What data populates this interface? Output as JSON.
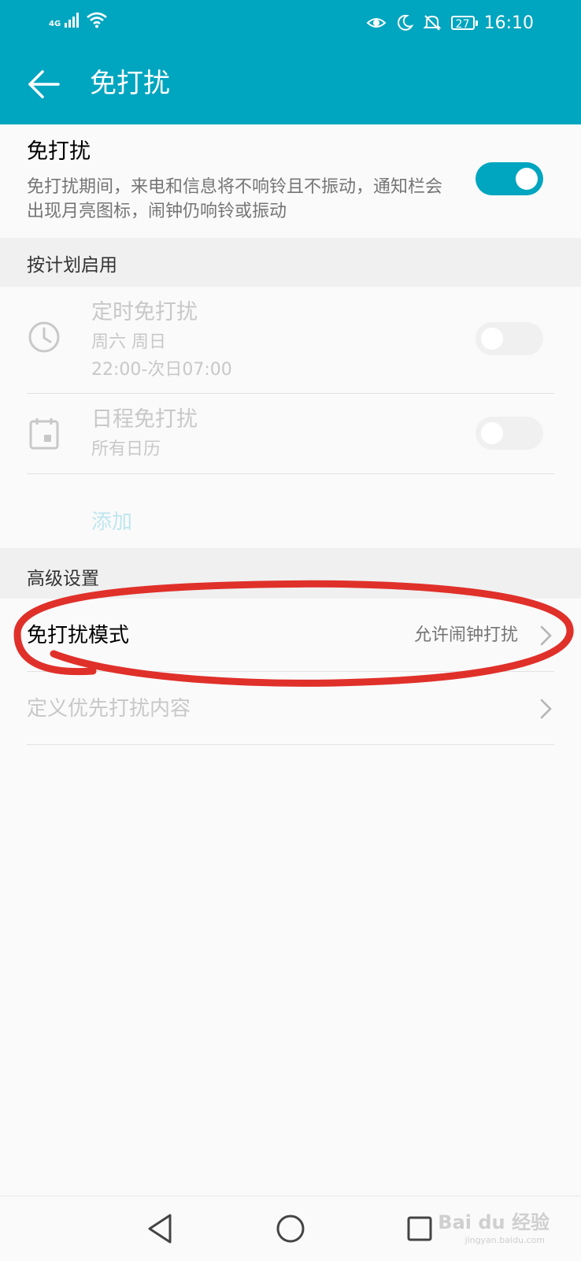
{
  "status_bar": {
    "network": "4G",
    "battery": "27",
    "time": "16:10",
    "icons": [
      "signal-icon",
      "wifi-icon",
      "eye-comfort-icon",
      "moon-icon",
      "mute-icon",
      "battery-icon"
    ]
  },
  "app_bar": {
    "title": "免打扰",
    "back_icon": "back-arrow-icon"
  },
  "dnd_main": {
    "title": "免打扰",
    "description": "免打扰期间，来电和信息将不响铃且不振动，通知栏会出现月亮图标，闹钟仍响铃或振动",
    "enabled": true
  },
  "schedule_section": {
    "header": "按计划启用",
    "items": [
      {
        "title": "定时免打扰",
        "days": "周六 周日",
        "time_range": "22:00-次日07:00",
        "icon": "clock-icon",
        "enabled": false
      },
      {
        "title": "日程免打扰",
        "calendars": "所有日历",
        "icon": "calendar-icon",
        "enabled": false
      }
    ],
    "add_label": "添加"
  },
  "advanced_section": {
    "header": "高级设置",
    "items": [
      {
        "title": "免打扰模式",
        "value": "允许闹钟打扰"
      },
      {
        "title": "定义优先打扰内容"
      }
    ]
  },
  "nav_bar": {
    "buttons": [
      "back-triangle-icon",
      "home-circle-icon",
      "recents-square-icon"
    ]
  },
  "watermark": {
    "brand": "Bai du 经验",
    "url": "jingyan.baidu.com"
  },
  "colors": {
    "accent": "#00a5bf",
    "annotation": "#e0302a"
  }
}
